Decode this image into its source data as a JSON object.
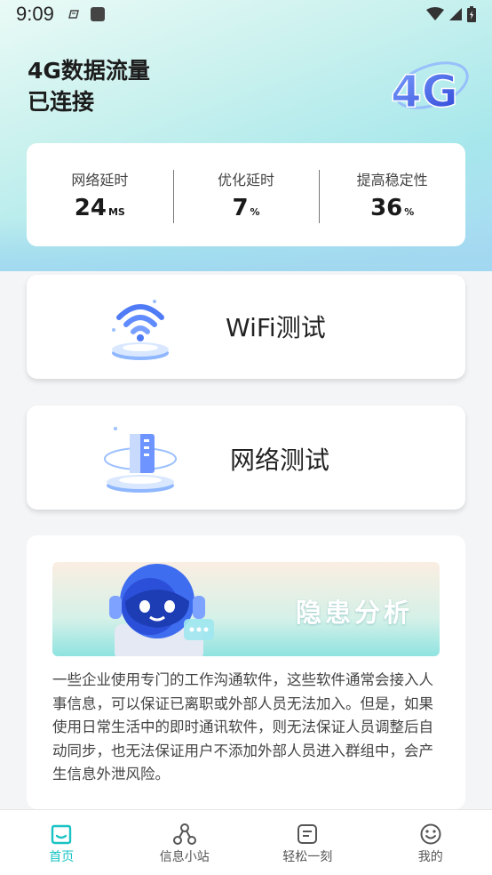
{
  "status_bar": {
    "time": "9:09"
  },
  "connection": {
    "title_line1": "4G数据流量",
    "title_line2": "已连接",
    "logo_text": "4G"
  },
  "stats": [
    {
      "label": "网络延时",
      "value": "24",
      "unit": "MS"
    },
    {
      "label": "优化延时",
      "value": "7",
      "unit": "%"
    },
    {
      "label": "提高稳定性",
      "value": "36",
      "unit": "%"
    }
  ],
  "features": {
    "wifi_test": "WiFi测试",
    "network_test": "网络测试"
  },
  "analysis": {
    "banner_title": "隐患分析",
    "body": "一些企业使用专门的工作沟通软件，这些软件通常会接入人事信息，可以保证已离职或外部人员无法加入。但是，如果使用日常生活中的即时通讯软件，则无法保证人员调整后自动同步，也无法保证用户不添加外部人员进入群组中，会产生信息外泄风险。"
  },
  "nav": [
    {
      "label": "首页",
      "icon": "home-icon",
      "active": true
    },
    {
      "label": "信息小站",
      "icon": "network-icon",
      "active": false
    },
    {
      "label": "轻松一刻",
      "icon": "message-icon",
      "active": false
    },
    {
      "label": "我的",
      "icon": "smile-icon",
      "active": false
    }
  ],
  "colors": {
    "accent": "#19c3c3",
    "header_start": "#eafaf6",
    "header_end": "#a9d8f4",
    "logo": "#3a5be0"
  }
}
